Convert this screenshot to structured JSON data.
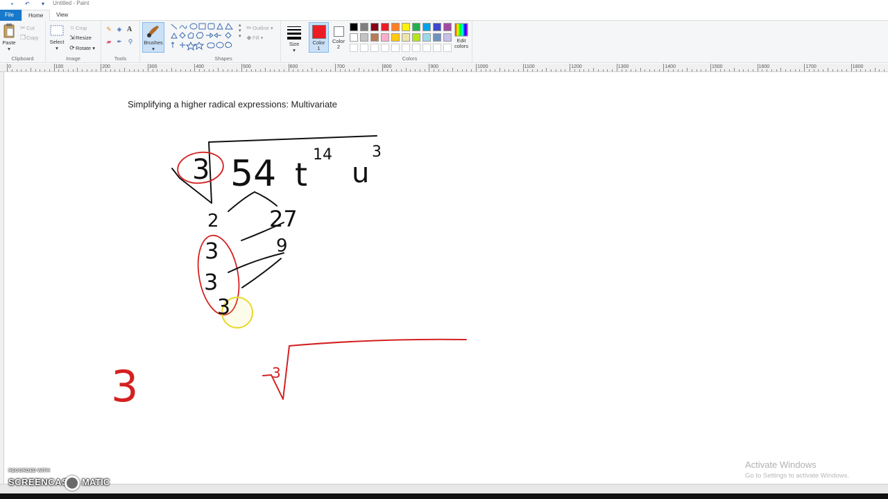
{
  "window": {
    "title": "Untitled - Paint"
  },
  "tabs": {
    "file": "File",
    "home": "Home",
    "view": "View"
  },
  "ribbon": {
    "clipboard": {
      "label": "Clipboard",
      "paste": "Paste",
      "cut": "Cut",
      "copy": "Copy"
    },
    "image": {
      "label": "Image",
      "select": "Select",
      "crop": "Crop",
      "resize": "Resize",
      "rotate": "Rotate"
    },
    "tools": {
      "label": "Tools"
    },
    "brushes": {
      "label": "Brushes"
    },
    "shapes": {
      "label": "Shapes",
      "outline": "Outline",
      "fill": "Fill"
    },
    "size": {
      "label": "Size"
    },
    "color1": {
      "label": "Color 1",
      "value": "#ed1c24"
    },
    "color2": {
      "label": "Color 2",
      "value": "#ffffff"
    },
    "colors": {
      "label": "Colors",
      "edit": "Edit colors",
      "palette_row1": [
        "#000000",
        "#7f7f7f",
        "#880015",
        "#ed1c24",
        "#ff7f27",
        "#fff200",
        "#22b14c",
        "#00a2e8",
        "#3f48cc",
        "#a349a4"
      ],
      "palette_row2": [
        "#ffffff",
        "#c3c3c3",
        "#b97a57",
        "#ffaec9",
        "#ffc90e",
        "#efe4b0",
        "#b5e61d",
        "#99d9ea",
        "#7092be",
        "#c8bfe7"
      ]
    }
  },
  "ruler": {
    "labels": [
      "0",
      "100",
      "200",
      "300",
      "400",
      "500",
      "600",
      "700",
      "800",
      "900",
      "1000",
      "1100",
      "1200",
      "1300",
      "1400",
      "1500",
      "1600",
      "1700",
      "1800"
    ]
  },
  "canvas": {
    "title_text": "Simplifying a higher radical expressions: Multivariate",
    "handwriting": {
      "radical_index": "3",
      "radicand_coef": "54",
      "var_t": "t",
      "exp_t": "14",
      "var_u": "u",
      "exp_u": "3",
      "factor_2": "2",
      "factor_27": "27",
      "factor_9": "9",
      "factor_3a": "3",
      "factor_3b": "3",
      "factor_3c": "3",
      "result_coef": "3",
      "result_index": "3"
    },
    "ink_colors": {
      "black": "#111111",
      "red": "#d42020",
      "highlight": "#e8d830"
    }
  },
  "activation": {
    "title": "Activate Windows",
    "subtitle": "Go to Settings to activate Windows."
  },
  "watermark": {
    "recorded": "RECORDED WITH",
    "brand_a": "SCREENCAST",
    "brand_b": "MATIC"
  }
}
